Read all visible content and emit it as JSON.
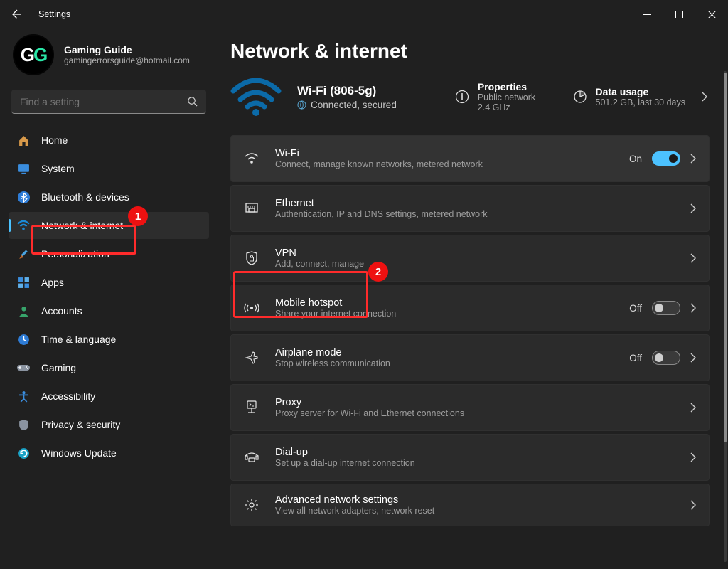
{
  "window": {
    "title": "Settings"
  },
  "profile": {
    "name": "Gaming Guide",
    "email": "gamingerrorsguide@hotmail.com",
    "avatar_initials_1": "G",
    "avatar_initials_2": "G"
  },
  "search": {
    "placeholder": "Find a setting"
  },
  "sidebar": {
    "items": [
      {
        "label": "Home"
      },
      {
        "label": "System"
      },
      {
        "label": "Bluetooth & devices"
      },
      {
        "label": "Network & internet"
      },
      {
        "label": "Personalization"
      },
      {
        "label": "Apps"
      },
      {
        "label": "Accounts"
      },
      {
        "label": "Time & language"
      },
      {
        "label": "Gaming"
      },
      {
        "label": "Accessibility"
      },
      {
        "label": "Privacy & security"
      },
      {
        "label": "Windows Update"
      }
    ],
    "active_index": 3
  },
  "page": {
    "title": "Network & internet",
    "hero": {
      "wifi_title": "Wi-Fi (806-5g)",
      "wifi_status": "Connected, secured",
      "properties_label": "Properties",
      "properties_sub": "Public network\n2.4 GHz",
      "data_label": "Data usage",
      "data_sub": "501.2 GB, last 30 days"
    },
    "rows": [
      {
        "title": "Wi-Fi",
        "sub": "Connect, manage known networks, metered network",
        "toggle": "On",
        "toggle_on": true
      },
      {
        "title": "Ethernet",
        "sub": "Authentication, IP and DNS settings, metered network"
      },
      {
        "title": "VPN",
        "sub": "Add, connect, manage"
      },
      {
        "title": "Mobile hotspot",
        "sub": "Share your internet connection",
        "toggle": "Off",
        "toggle_on": false
      },
      {
        "title": "Airplane mode",
        "sub": "Stop wireless communication",
        "toggle": "Off",
        "toggle_on": false
      },
      {
        "title": "Proxy",
        "sub": "Proxy server for Wi-Fi and Ethernet connections"
      },
      {
        "title": "Dial-up",
        "sub": "Set up a dial-up internet connection"
      },
      {
        "title": "Advanced network settings",
        "sub": "View all network adapters, network reset"
      }
    ]
  },
  "annotations": {
    "badge1": "1",
    "badge2": "2"
  },
  "colors": {
    "accent": "#4cc2ff",
    "annotation": "#ff2b2b",
    "bg": "#202020",
    "row": "#2b2b2b"
  }
}
